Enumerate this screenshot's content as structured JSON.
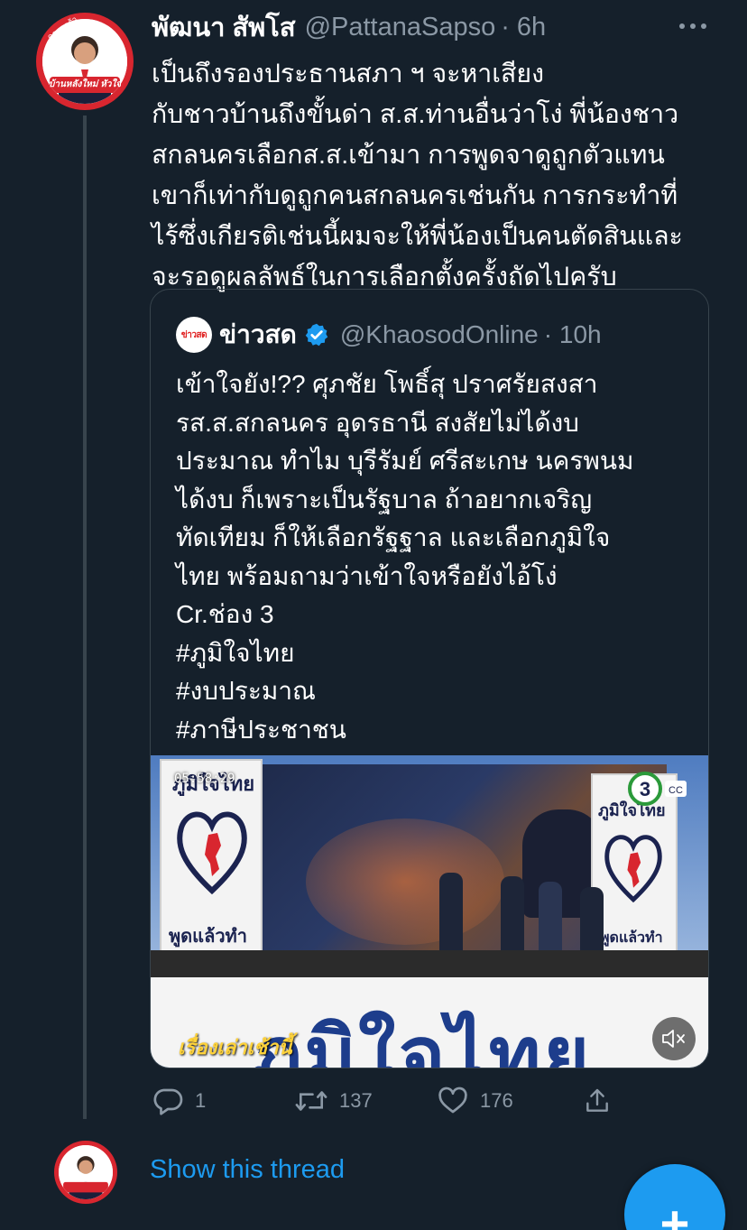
{
  "tweet": {
    "author_name": "พัฒนา สัพโส",
    "author_handle": "@PattanaSapso",
    "time": "· 6h",
    "text_lines": [
      "เป็นถึงรองประธานสภา ฯ จะหาเสียง",
      "กับชาวบ้านถึงขั้นด่า ส.ส.ท่านอื่นว่าโง่ พี่น้องชาว",
      "สกลนครเลือกส.ส.เข้ามา การพูดจาดูถูกตัวแทน",
      "เขาก็เท่ากับดูถูกคนสกลนครเช่นกัน การกระทำที่",
      "ไร้ซึ่งเกียรติเช่นนี้ผมจะให้พี่น้องเป็นคนตัดสินและ",
      "จะรอดูผลลัพธ์ในการเลือกตั้งครั้งถัดไปครับ"
    ],
    "avatar_text": "บ้านหลังใหม่ หัวใจเดิม",
    "avatar_top_text": "ครอบครัว",
    "actions": {
      "reply_count": "1",
      "retweet_count": "137",
      "like_count": "176"
    }
  },
  "quote": {
    "author_name": "ข่าวสด",
    "author_handle": "@KhaosodOnline",
    "time": "· 10h",
    "avatar_text": "ข่าวสด",
    "text_lines": [
      "เข้าใจยัง!?? ศุภชัย โพธิ์สุ ปราศรัยสงสา",
      "รส.ส.สกลนคร อุดรธานี สงสัยไม่ได้งบ",
      "ประมาณ ทำไม บุรีรัมย์ ศรีสะเกษ นครพนม",
      "ได้งบ ก็เพราะเป็นรัฐบาล ถ้าอยากเจริญ",
      "ทัดเทียม ก็ให้เลือกรัฐฐาล และเลือกภูมิใจ",
      "ไทย พร้อมถามว่าเข้าใจหรือยังไอ้โง่",
      "Cr.ช่อง 3",
      "#ภูมิใจไทย",
      "#งบประมาณ",
      "#ภาษีประชาชน"
    ],
    "media": {
      "timestamp": "05:58:29",
      "banner_left_top": "ภูมิใจไทย",
      "banner_left_bottom": "พูดแล้วทำ",
      "banner_right_top": "ภูมิใจไทย",
      "banner_right_bottom": "พูดแล้วทำ",
      "big_banner": "ภูมิใจไทย",
      "channel_logo": "3",
      "watermark": "เรื่องเล่าเช้านี้"
    }
  },
  "show_thread": "Show this thread",
  "colors": {
    "background": "#15202b",
    "accent": "#1d9bf0",
    "secondary_text": "#8b98a5",
    "border": "#38444d"
  }
}
